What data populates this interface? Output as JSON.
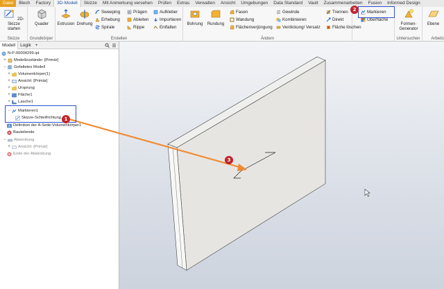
{
  "tabs": [
    "Datei",
    "Blech",
    "Factory",
    "3D-Modell",
    "Skizze",
    "Mit Anmerkung versehen",
    "Prüfen",
    "Extras",
    "Verwalten",
    "Ansicht",
    "Umgebungen",
    "Data Standard",
    "Vault",
    "Zusammenarbeiten",
    "Fusion",
    "Informed Design"
  ],
  "ribbon": {
    "skizze": {
      "btn": "2D-Skizze starten",
      "label": "Skizze"
    },
    "grundkoerper": {
      "btn": "Quader",
      "label": "Grundkörper"
    },
    "erstellen": {
      "extrusion": "Extrusion",
      "drehung": "Drehung",
      "sweeping": "Sweeping",
      "erhebung": "Erhebung",
      "spirale": "Spirale",
      "praegen": "Prägen",
      "ableiten": "Ableiten",
      "rippe": "Rippe",
      "aufkleber": "Aufkleber",
      "importieren": "Importieren",
      "entfalten": "Entfalten",
      "label": "Erstellen"
    },
    "aendern": {
      "bohrung": "Bohrung",
      "rundung": "Rundung",
      "fasen": "Fasen",
      "wandung": "Wandung",
      "flaechenverjuengung": "Flächenverjüngung",
      "gewinde": "Gewinde",
      "kombinieren": "Kombinieren",
      "verdickung": "Verdickung/ Versatz",
      "trennen": "Trennen",
      "direkt": "Direkt",
      "flaeche_loeschen": "Fläche löschen",
      "label": "Ändern"
    },
    "markieren": {
      "btn": "Markieren",
      "oberflaeche": "Oberfläche"
    },
    "untersuchen": {
      "btn": "Formen-Generator",
      "label": "Untersuchen"
    },
    "arbeits": {
      "btn": "Ebene",
      "label": "Arbeits"
    }
  },
  "panel": {
    "tabs": [
      "Modell",
      "Logik"
    ],
    "plus": "+",
    "tree": [
      {
        "text": "N-P-00004299.ipt",
        "grey": false
      },
      {
        "text": "Modellzustände: [Primär]",
        "grey": false
      },
      {
        "text": "Gefaltetes Modell",
        "grey": false
      },
      {
        "text": "Volumenkörper(1)",
        "grey": false
      },
      {
        "text": "Ansicht: [Primär]",
        "grey": false
      },
      {
        "text": "Ursprung",
        "grey": false
      },
      {
        "text": "Fläche1",
        "grey": false
      },
      {
        "text": "Lasche1",
        "grey": false
      },
      {
        "text": "Markieren1",
        "grey": false
      },
      {
        "text": "Skizze-Schleifrichtung",
        "grey": false
      },
      {
        "text": "Definition der A-Seite:Volumenkörper1",
        "grey": false
      },
      {
        "text": "Bauteilende",
        "grey": false
      },
      {
        "text": "Abwicklung",
        "grey": true
      },
      {
        "text": "Ansicht: [Primär]",
        "grey": true
      },
      {
        "text": "Ende der Abwicklung",
        "grey": true
      }
    ]
  },
  "callouts": [
    "1",
    "2",
    "3"
  ],
  "colors": {
    "accent": "#1a4f9c",
    "callout": "#c0262d",
    "arrow": "#f08a30",
    "highlight": "#3050d0",
    "file_tab": "#e8a020"
  }
}
